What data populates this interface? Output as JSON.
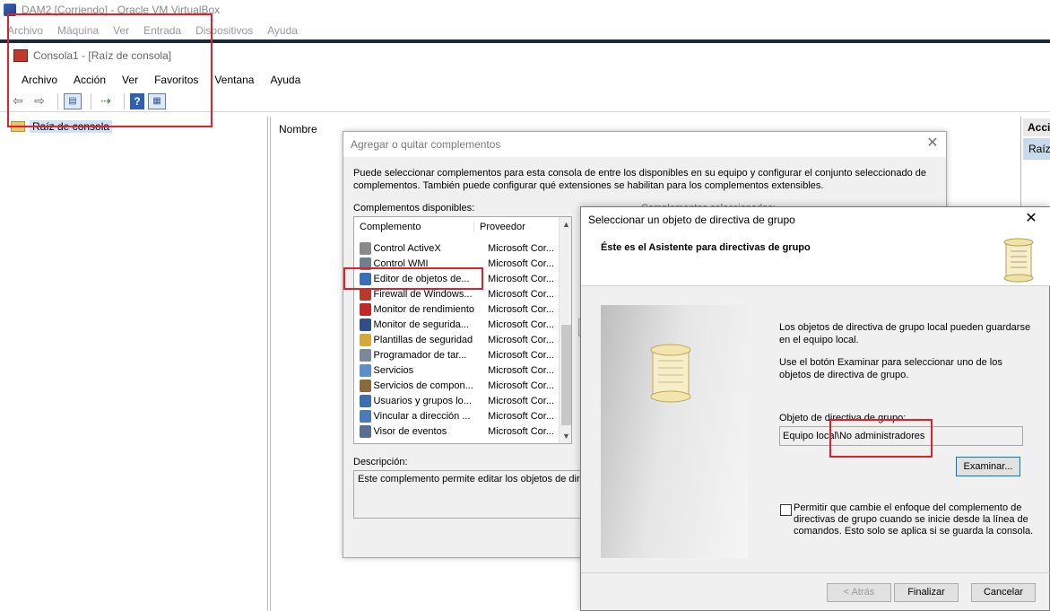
{
  "vbox": {
    "title": "DAM2 [Corriendo] - Oracle VM VirtualBox",
    "menu": [
      "Archivo",
      "Máquina",
      "Ver",
      "Entrada",
      "Dispositivos",
      "Ayuda"
    ]
  },
  "mmc": {
    "title": "Consola1 - [Raíz de consola]",
    "menu": [
      "Archivo",
      "Acción",
      "Ver",
      "Favoritos",
      "Ventana",
      "Ayuda"
    ],
    "tree_root": "Raíz de consola",
    "center_column": "Nombre",
    "actions_header": "Acciones",
    "actions_item": "Raíz de consola"
  },
  "dialog_snapins": {
    "title": "Agregar o quitar complementos",
    "description": "Puede seleccionar complementos para esta consola de entre los disponibles en su equipo y configurar el conjunto seleccionado de complementos. También puede configurar qué extensiones se habilitan para los complementos extensibles.",
    "available_label": "Complementos disponibles:",
    "selected_label": "Complementos seleccionados:",
    "columns": [
      "Complemento",
      "Proveedor"
    ],
    "rows": [
      {
        "name": "Control ActiveX",
        "vendor": "Microsoft Cor...",
        "icon": "activex-icon",
        "color": "#8a8a8a"
      },
      {
        "name": "Control WMI",
        "vendor": "Microsoft Cor...",
        "icon": "wmi-icon",
        "color": "#6f7f8f"
      },
      {
        "name": "Editor de objetos de...",
        "vendor": "Microsoft Cor...",
        "icon": "gpo-editor-icon",
        "color": "#3b6fb5"
      },
      {
        "name": "Firewall de Windows...",
        "vendor": "Microsoft Cor...",
        "icon": "firewall-icon",
        "color": "#b83a2a"
      },
      {
        "name": "Monitor de rendimiento",
        "vendor": "Microsoft Cor...",
        "icon": "perfmon-icon",
        "color": "#c0282a"
      },
      {
        "name": "Monitor de segurida...",
        "vendor": "Microsoft Cor...",
        "icon": "security-monitor-icon",
        "color": "#2e4f8a"
      },
      {
        "name": "Plantillas de seguridad",
        "vendor": "Microsoft Cor...",
        "icon": "security-templates-icon",
        "color": "#d4a83a"
      },
      {
        "name": "Programador de tar...",
        "vendor": "Microsoft Cor...",
        "icon": "task-scheduler-icon",
        "color": "#7a8899"
      },
      {
        "name": "Servicios",
        "vendor": "Microsoft Cor...",
        "icon": "services-icon",
        "color": "#5d8fc9"
      },
      {
        "name": "Servicios de compon...",
        "vendor": "Microsoft Cor...",
        "icon": "component-services-icon",
        "color": "#8a6a3a"
      },
      {
        "name": "Usuarios y grupos lo...",
        "vendor": "Microsoft Cor...",
        "icon": "users-groups-icon",
        "color": "#3d6fb0"
      },
      {
        "name": "Vincular a dirección ...",
        "vendor": "Microsoft Cor...",
        "icon": "link-address-icon",
        "color": "#4a7ab8"
      },
      {
        "name": "Visor de eventos",
        "vendor": "Microsoft Cor...",
        "icon": "event-viewer-icon",
        "color": "#5a6f8f"
      }
    ],
    "desc_label": "Descripción:",
    "desc_text": "Este complemento permite editar los objetos de dire"
  },
  "dialog_gpo": {
    "title": "Seleccionar un objeto de directiva de grupo",
    "heading": "Éste es el Asistente para directivas de grupo",
    "p1": "Los objetos de directiva de grupo local pueden guardarse en el equipo local.",
    "p2": "Use el botón Examinar para seleccionar uno de los objetos de directiva de grupo.",
    "object_label": "Objeto de directiva de grupo:",
    "object_value": "Equipo local\\No administradores",
    "browse": "Examinar...",
    "checkbox_text": "Permitir que cambie el enfoque del complemento de directivas de grupo cuando se inicie desde la línea de comandos. Esto solo se aplica si se guarda la consola.",
    "back": "< Atrás",
    "finish": "Finalizar",
    "cancel": "Cancelar"
  },
  "colors": {
    "annotation_red": "#e0202a",
    "accent_blue": "#0078d7"
  }
}
